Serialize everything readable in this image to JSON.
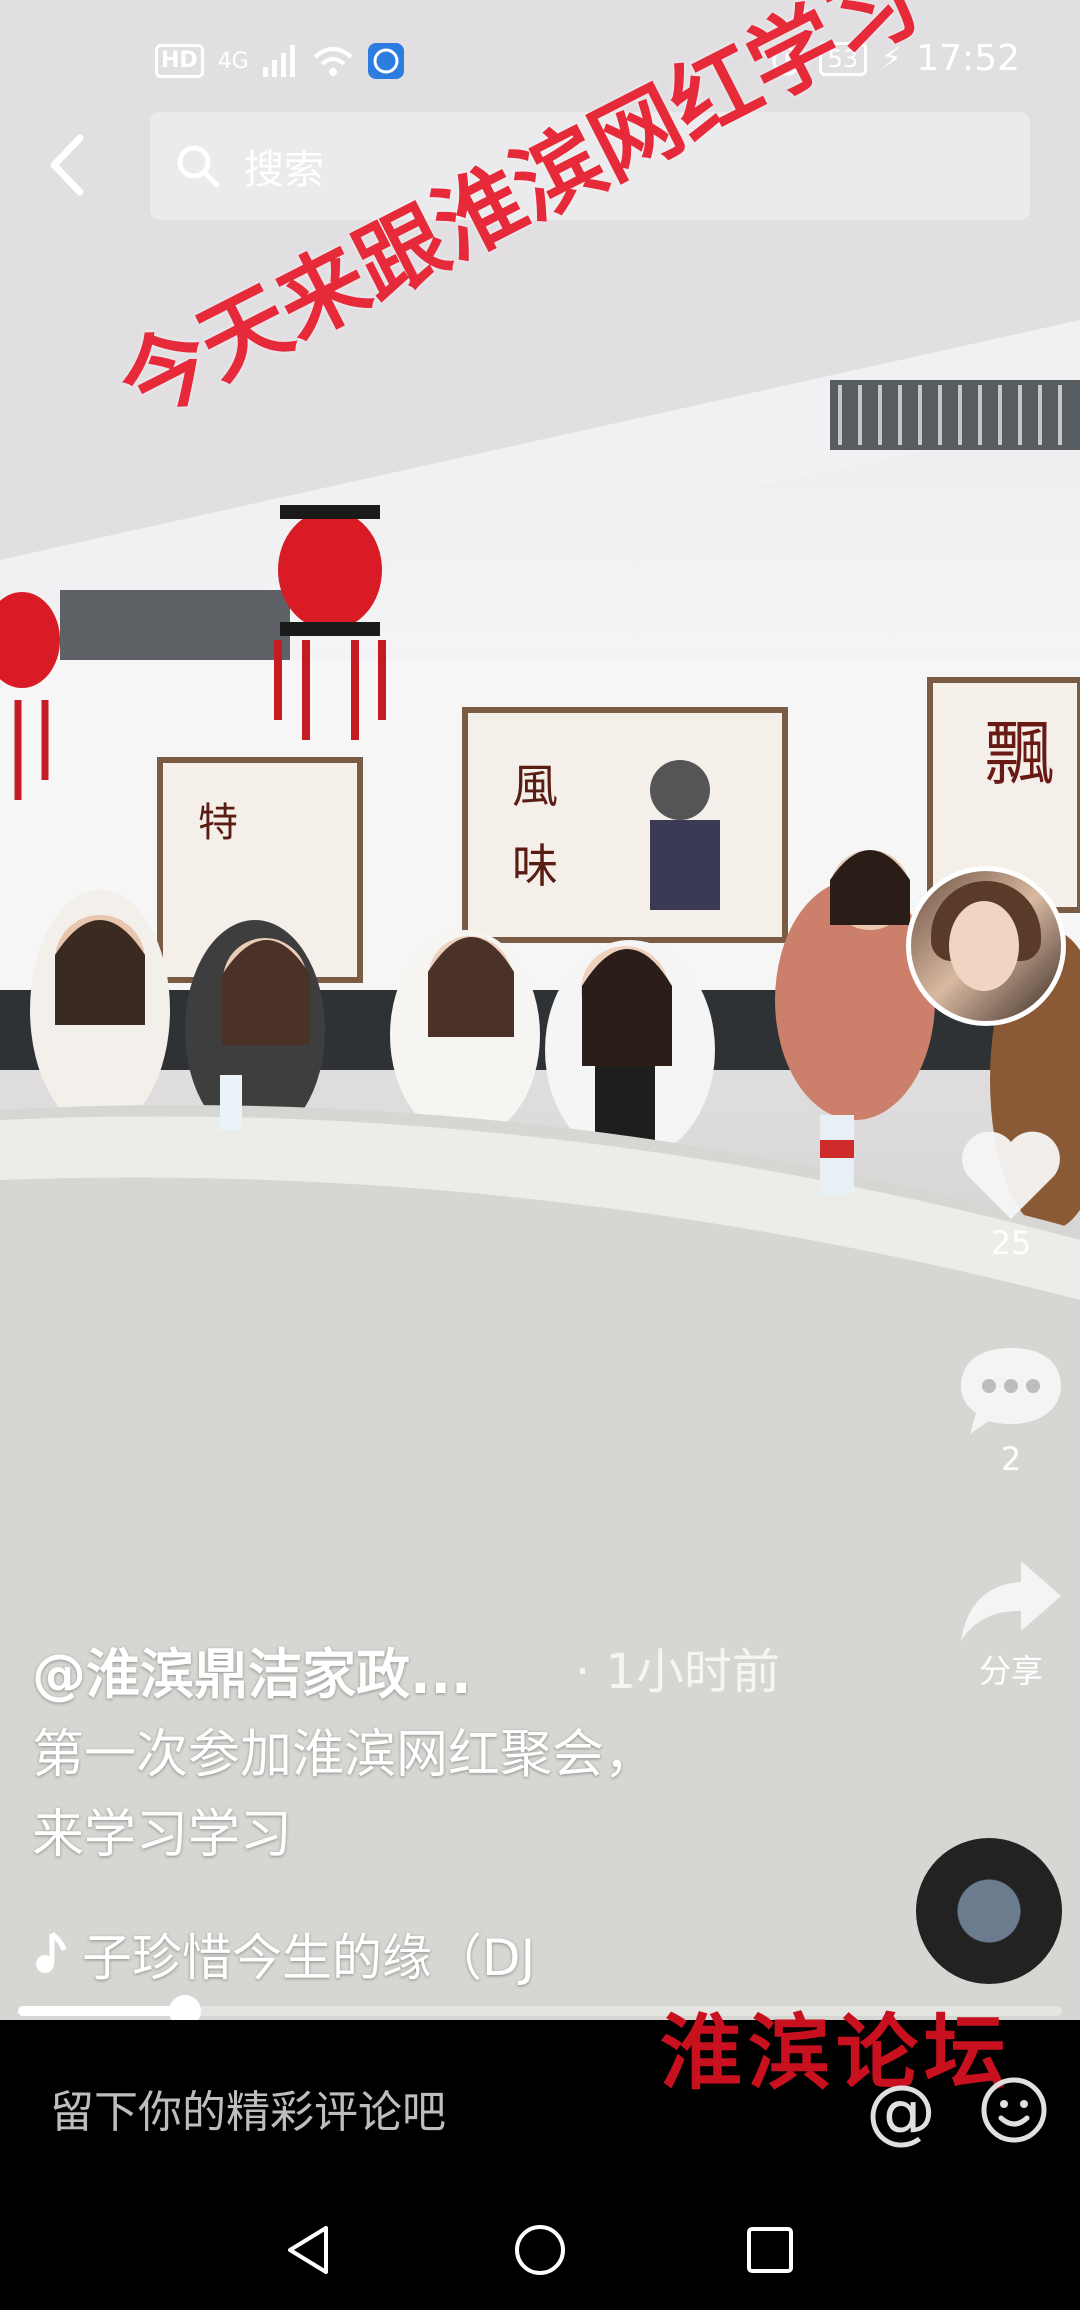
{
  "status_bar": {
    "left_badges": [
      "HD",
      "4G"
    ],
    "battery": "53",
    "time": "17:52"
  },
  "search": {
    "placeholder": "搜索"
  },
  "video": {
    "overlay_caption": "今天来跟淮滨网红学习",
    "wall_text_1": "風",
    "wall_text_2": "味",
    "wall_text_3": "特",
    "wall_text_4": "飄"
  },
  "side_actions": {
    "like_count": "25",
    "comment_count": "2",
    "share_label": "分享"
  },
  "post": {
    "author": "@淮滨鼎洁家政...",
    "time": "· 1小时前",
    "description_line1": "第一次参加淮滨网红聚会，",
    "description_line2": "来学习学习",
    "music": "子珍惜今生的缘（DJ"
  },
  "progress": {
    "fraction": 0.16
  },
  "comment_bar": {
    "placeholder": "留下你的精彩评论吧",
    "watermark": "淮滨论坛",
    "at_symbol": "@"
  },
  "icons": {
    "back": "back-arrow-icon",
    "search": "search-icon",
    "like": "heart-icon",
    "comment": "comment-bubble-icon",
    "share": "share-arrow-icon",
    "music": "music-note-icon",
    "emoji": "emoji-icon"
  },
  "colors": {
    "caption": "#e62a3a",
    "watermark": "#c9101f"
  }
}
